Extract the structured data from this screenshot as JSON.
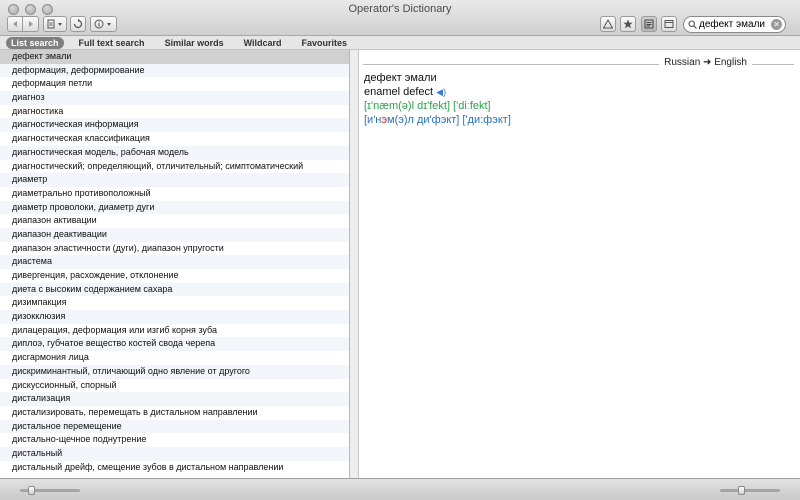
{
  "window": {
    "title": "Operator's Dictionary"
  },
  "toolbar": {
    "back_icon": "back-arrow-icon",
    "forward_icon": "forward-arrow-icon",
    "search_value": "дефект эмали",
    "search_placeholder": "Search"
  },
  "tabs": [
    {
      "label": "List search",
      "active": true
    },
    {
      "label": "Full text search",
      "active": false
    },
    {
      "label": "Similar words",
      "active": false
    },
    {
      "label": "Wildcard",
      "active": false
    },
    {
      "label": "Favourites",
      "active": false
    }
  ],
  "list": [
    "дефект эмали",
    "деформация, деформирование",
    "деформация петли",
    "диагноз",
    "диагностика",
    "диагностическая информация",
    "диагностическая классификация",
    "диагностическая модель, рабочая модель",
    "диагностический; определяющий, отличительный; симптоматический",
    "диаметр",
    "диаметрально противоположный",
    "диаметр проволоки, диаметр дуги",
    "диапазон активации",
    "диапазон деактивации",
    "диапазон эластичности (дуги), диапазон упругости",
    "диастема",
    "дивергенция, расхождение, отклонение",
    "диета с высоким содержанием сахара",
    "дизимпакция",
    "дизокклюзия",
    "дилацерация, деформация или изгиб корня зуба",
    "диплоэ, губчатое вещество костей свода черепа",
    "дисгармония лица",
    "дискриминантный, отличающий одно явление от другого",
    "дискуссионный, спорный",
    "дистализация",
    "дистализировать, перемещать в дистальном направлении",
    "дистальное перемещение",
    "дистально-щечное поднутрение",
    "дистальный",
    "дистальный дрейф, смещение зубов в дистальном направлении"
  ],
  "entry": {
    "direction": "Russian ➜ English",
    "headword": "дефект эмали",
    "translation": "enamel defect",
    "ipa": "[ɪ'næm(ə)l dɪ'fekt] ['diːfekt]",
    "ru_transcription_pre": "[и'н",
    "ru_transcription_stress": "э",
    "ru_transcription_post": "м(э)л ди'фэкт] ['ди:фэкт]"
  },
  "colors": {
    "ipa": "#2aa34a",
    "transcription": "#2673b8",
    "stress": "#e02020",
    "selected_row": "#d0d0d0"
  }
}
